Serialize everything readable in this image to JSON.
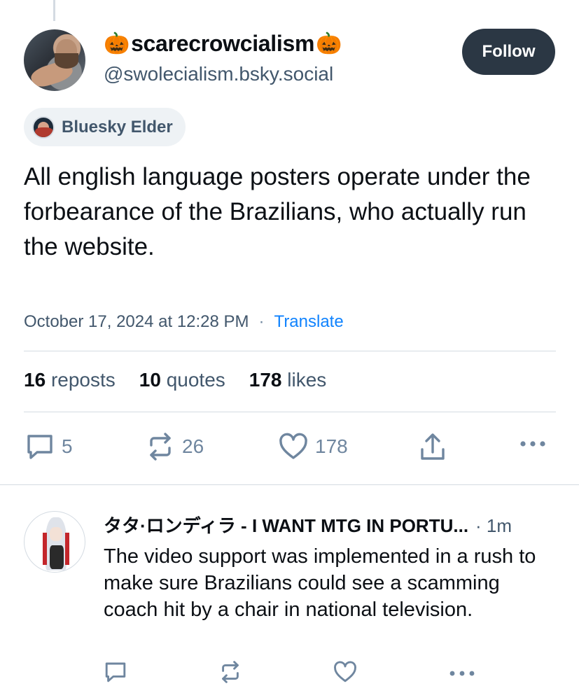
{
  "post": {
    "author": {
      "display_name": "scarecrowcialism",
      "name_emoji_left": "🎃",
      "name_emoji_right": "🎃",
      "handle": "@swolecialism.bsky.social"
    },
    "follow_label": "Follow",
    "badge_label": "Bluesky Elder",
    "text": "All english language posters operate under the forbearance of the Brazilians, who actually run the website.",
    "timestamp": "October 17, 2024 at 12:28 PM",
    "separator": "·",
    "translate_label": "Translate",
    "stats": {
      "reposts_count": "16",
      "reposts_label": "reposts",
      "quotes_count": "10",
      "quotes_label": "quotes",
      "likes_count": "178",
      "likes_label": "likes"
    },
    "actions": {
      "reply_count": "5",
      "repost_count": "26",
      "like_count": "178"
    }
  },
  "reply": {
    "author_display": "タタ·ロンディラ - I WANT MTG IN PORTU...",
    "time": "· 1m",
    "text": "The video support was implemented in a rush to make sure Brazilians could see a scamming coach hit by a chair in national television."
  },
  "icons": {
    "reply": "speech-bubble-icon",
    "repost": "repost-arrows-icon",
    "like": "heart-icon",
    "share": "share-upload-icon",
    "more": "more-dots-icon"
  },
  "colors": {
    "primary_text": "#0b0f14",
    "secondary_text": "#42576c",
    "icon_gray": "#6f869f",
    "link_blue": "#1083fe",
    "follow_bg": "#2b3744",
    "badge_bg": "#eef2f5",
    "divider": "#d4dbe2"
  }
}
